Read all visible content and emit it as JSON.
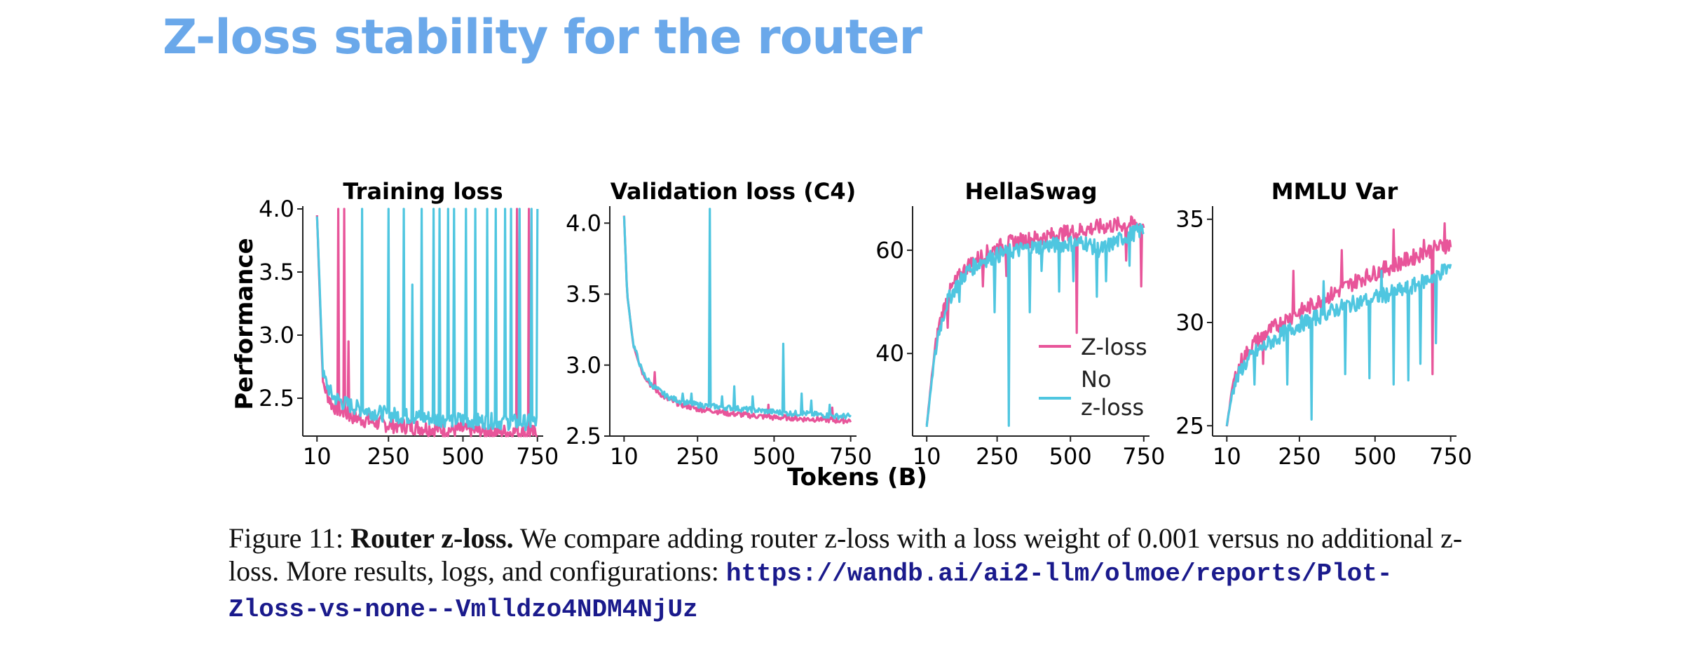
{
  "slide": {
    "title": "Z-loss stability for the router"
  },
  "figure": {
    "ylabel": "Performance",
    "xlabel": "Tokens (B)",
    "series_colors": {
      "Z-loss": "#e8559a",
      "No z-loss": "#4fc6e0"
    }
  },
  "chart_data": [
    {
      "type": "line",
      "title": "Training loss",
      "x_ticks": [
        10,
        250,
        500,
        750
      ],
      "xlim": [
        0,
        760
      ],
      "ylim": [
        2.2,
        4.0
      ],
      "y_ticks": [
        "2.5",
        "3.0",
        "3.5",
        "4.0"
      ],
      "series": [
        {
          "name": "Z-loss",
          "color": "#e8559a",
          "x": [
            10,
            30,
            60,
            100,
            150,
            200,
            250,
            300,
            350,
            400,
            450,
            500,
            550,
            600,
            650,
            700,
            750
          ],
          "y": [
            3.95,
            2.62,
            2.45,
            2.38,
            2.34,
            2.31,
            2.29,
            2.28,
            2.27,
            2.26,
            2.25,
            2.25,
            2.24,
            2.24,
            2.23,
            2.23,
            2.22
          ],
          "spikes": [
            [
              80,
              4.0
            ],
            [
              100,
              4.0
            ],
            [
              115,
              2.95
            ],
            [
              680,
              4.0
            ],
            [
              720,
              4.0
            ]
          ]
        },
        {
          "name": "No z-loss",
          "color": "#4fc6e0",
          "x": [
            10,
            30,
            60,
            100,
            150,
            200,
            250,
            300,
            350,
            400,
            450,
            500,
            550,
            600,
            650,
            700,
            750
          ],
          "y": [
            3.95,
            2.68,
            2.52,
            2.46,
            2.42,
            2.39,
            2.37,
            2.36,
            2.35,
            2.34,
            2.33,
            2.33,
            2.32,
            2.32,
            2.31,
            2.31,
            2.31
          ],
          "spikes": [
            [
              160,
              4.0
            ],
            [
              250,
              4.0
            ],
            [
              300,
              4.0
            ],
            [
              330,
              3.4
            ],
            [
              360,
              4.0
            ],
            [
              400,
              4.0
            ],
            [
              420,
              4.0
            ],
            [
              450,
              4.0
            ],
            [
              470,
              4.0
            ],
            [
              510,
              4.0
            ],
            [
              540,
              4.0
            ],
            [
              580,
              4.0
            ],
            [
              610,
              4.0
            ],
            [
              640,
              4.0
            ],
            [
              660,
              4.0
            ],
            [
              690,
              4.0
            ],
            [
              730,
              4.0
            ],
            [
              750,
              4.0
            ]
          ]
        }
      ]
    },
    {
      "type": "line",
      "title": "Validation loss (C4)",
      "x_ticks": [
        10,
        250,
        500,
        750
      ],
      "xlim": [
        0,
        760
      ],
      "ylim": [
        2.5,
        4.1
      ],
      "y_ticks": [
        "2.5",
        "3.0",
        "3.5",
        "4.0"
      ],
      "series": [
        {
          "name": "Z-loss",
          "color": "#e8559a",
          "x": [
            10,
            20,
            40,
            70,
            100,
            150,
            200,
            250,
            300,
            350,
            400,
            450,
            500,
            550,
            600,
            650,
            700,
            750
          ],
          "y": [
            4.05,
            3.5,
            3.15,
            2.95,
            2.85,
            2.76,
            2.72,
            2.69,
            2.68,
            2.66,
            2.65,
            2.64,
            2.63,
            2.63,
            2.62,
            2.62,
            2.61,
            2.61
          ],
          "spikes": [
            [
              110,
              2.95
            ],
            [
              480,
              2.72
            ],
            [
              690,
              2.7
            ]
          ]
        },
        {
          "name": "No z-loss",
          "color": "#4fc6e0",
          "x": [
            10,
            20,
            40,
            70,
            100,
            150,
            200,
            250,
            300,
            350,
            400,
            450,
            500,
            550,
            600,
            650,
            700,
            750
          ],
          "y": [
            4.05,
            3.5,
            3.15,
            2.95,
            2.86,
            2.78,
            2.74,
            2.72,
            2.71,
            2.7,
            2.69,
            2.68,
            2.67,
            2.66,
            2.66,
            2.65,
            2.64,
            2.64
          ],
          "spikes": [
            [
              200,
              2.8
            ],
            [
              230,
              2.8
            ],
            [
              290,
              4.1
            ],
            [
              330,
              2.78
            ],
            [
              370,
              2.85
            ],
            [
              430,
              2.78
            ],
            [
              530,
              3.15
            ],
            [
              590,
              2.8
            ],
            [
              620,
              2.75
            ],
            [
              680,
              2.72
            ]
          ]
        }
      ]
    },
    {
      "type": "line",
      "title": "HellaSwag",
      "x_ticks": [
        10,
        250,
        500,
        750
      ],
      "xlim": [
        0,
        760
      ],
      "ylim": [
        24,
        68
      ],
      "y_ticks": [
        "40",
        "60"
      ],
      "legend": {
        "position": "lower-right",
        "entries": [
          "Z-loss",
          "No z-loss"
        ],
        "labels": [
          "Z-loss",
          "No",
          "z-loss"
        ]
      },
      "series": [
        {
          "name": "Z-loss",
          "color": "#e8559a",
          "x": [
            10,
            30,
            50,
            80,
            110,
            150,
            200,
            250,
            300,
            350,
            400,
            450,
            500,
            550,
            600,
            650,
            700,
            750
          ],
          "y": [
            26,
            37,
            45,
            51,
            54,
            57,
            59,
            60.5,
            61.5,
            62,
            62.5,
            63,
            63.5,
            64,
            64.5,
            64.8,
            65,
            65
          ],
          "spikes": [
            [
              80,
              45
            ],
            [
              200,
              53
            ],
            [
              280,
              55
            ],
            [
              520,
              44
            ],
            [
              690,
              58
            ],
            [
              740,
              53
            ]
          ]
        },
        {
          "name": "No z-loss",
          "color": "#4fc6e0",
          "x": [
            10,
            30,
            50,
            80,
            110,
            150,
            200,
            250,
            300,
            350,
            400,
            450,
            500,
            550,
            600,
            650,
            700,
            750
          ],
          "y": [
            26,
            36,
            44,
            50,
            53,
            56,
            58,
            59,
            59.8,
            60.3,
            60.8,
            61,
            61.3,
            61.5,
            60,
            61.5,
            63,
            64
          ],
          "spikes": [
            [
              120,
              50
            ],
            [
              240,
              48
            ],
            [
              290,
              26
            ],
            [
              360,
              48
            ],
            [
              400,
              56
            ],
            [
              460,
              52
            ],
            [
              510,
              54
            ],
            [
              590,
              51
            ],
            [
              620,
              54
            ],
            [
              700,
              57
            ]
          ]
        }
      ]
    },
    {
      "type": "line",
      "title": "MMLU Var",
      "x_ticks": [
        10,
        250,
        500,
        750
      ],
      "xlim": [
        0,
        760
      ],
      "ylim": [
        24.5,
        35.5
      ],
      "y_ticks": [
        "25",
        "30",
        "35"
      ],
      "series": [
        {
          "name": "Z-loss",
          "color": "#e8559a",
          "x": [
            10,
            30,
            60,
            100,
            150,
            200,
            250,
            300,
            350,
            400,
            450,
            500,
            550,
            600,
            650,
            700,
            750
          ],
          "y": [
            25,
            27,
            28.2,
            29,
            29.6,
            30.1,
            30.5,
            30.9,
            31.3,
            31.7,
            32.1,
            32.4,
            32.7,
            33,
            33.3,
            33.6,
            33.8
          ],
          "spikes": [
            [
              130,
              28
            ],
            [
              230,
              32.5
            ],
            [
              390,
              33.5
            ],
            [
              560,
              34.5
            ],
            [
              660,
              34
            ],
            [
              690,
              27.5
            ],
            [
              730,
              34.8
            ]
          ]
        },
        {
          "name": "No z-loss",
          "color": "#4fc6e0",
          "x": [
            10,
            30,
            60,
            100,
            150,
            200,
            250,
            300,
            350,
            400,
            450,
            500,
            550,
            600,
            650,
            700,
            750
          ],
          "y": [
            25,
            26.8,
            27.8,
            28.5,
            29,
            29.5,
            29.9,
            30.2,
            30.5,
            30.8,
            31,
            31.2,
            31.4,
            31.6,
            31.9,
            32.3,
            32.7
          ],
          "spikes": [
            [
              100,
              27
            ],
            [
              210,
              27
            ],
            [
              290,
              25.3
            ],
            [
              330,
              32
            ],
            [
              400,
              27.5
            ],
            [
              480,
              27.3
            ],
            [
              520,
              32.5
            ],
            [
              560,
              27
            ],
            [
              610,
              27.2
            ],
            [
              650,
              28
            ],
            [
              700,
              29
            ]
          ]
        }
      ]
    }
  ],
  "caption": {
    "fig_label": "Figure 11:",
    "bold_title": "Router z-loss.",
    "text": "We compare adding router z-loss with a loss weight of 0.001 versus no additional z-loss. More results, logs, and configurations:",
    "url": "https://wandb.ai/ai2-llm/olmoe/reports/Plot-Zloss-vs-none--Vmlldzo4NDM4NjUz"
  }
}
